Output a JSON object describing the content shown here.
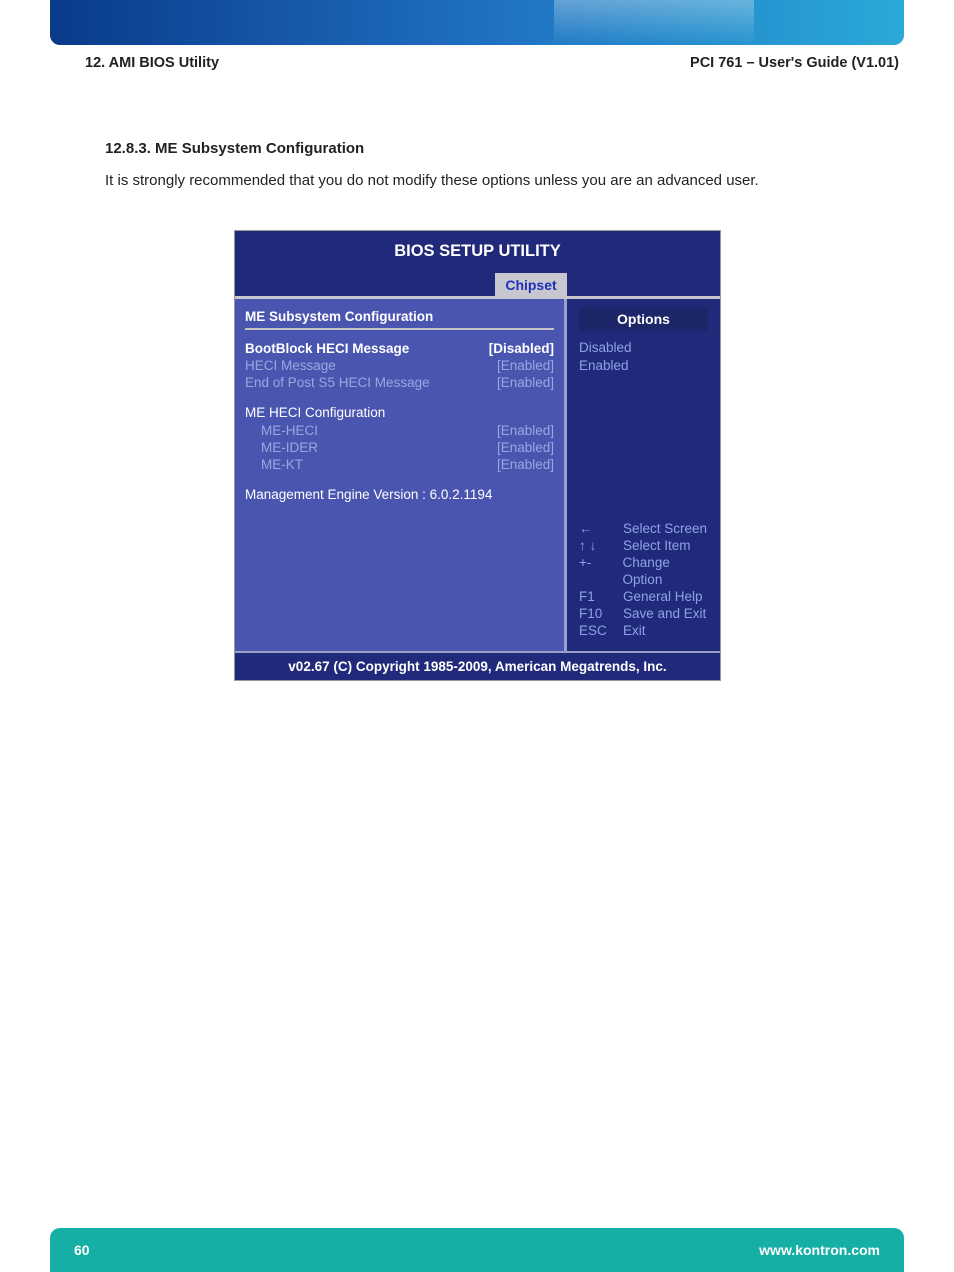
{
  "header": {
    "left": "12. AMI BIOS Utility",
    "right": "PCI 761 – User's Guide (V1.01)"
  },
  "section": {
    "number_title": "12.8.3. ME Subsystem Configuration",
    "intro": "It is strongly recommended that you do not modify these options unless you are an advanced user."
  },
  "bios": {
    "title": "BIOS SETUP UTILITY",
    "active_tab": "Chipset",
    "panel_title": "ME Subsystem Configuration",
    "settings_a": [
      {
        "label": "BootBlock HECI Message",
        "value": "[Disabled]",
        "active": true
      },
      {
        "label": "HECI Message",
        "value": "[Enabled]",
        "active": false
      },
      {
        "label": "End of Post S5 HECI Message",
        "value": "[Enabled]",
        "active": false
      }
    ],
    "subhead": "ME HECI Configuration",
    "settings_b": [
      {
        "label": "ME-HECI",
        "value": "[Enabled]"
      },
      {
        "label": "ME-IDER",
        "value": "[Enabled]"
      },
      {
        "label": "ME-KT",
        "value": "[Enabled]"
      }
    ],
    "me_version": "Management Engine Version  : 6.0.2.1194",
    "options_header": "Options",
    "options": [
      "Disabled",
      "Enabled"
    ],
    "nav": [
      {
        "key": "←",
        "desc": "Select Screen"
      },
      {
        "key": "↑ ↓",
        "desc": "Select Item"
      },
      {
        "key": "+-",
        "desc": "Change Option"
      },
      {
        "key": "F1",
        "desc": "General Help"
      },
      {
        "key": "F10",
        "desc": "Save and Exit"
      },
      {
        "key": "ESC",
        "desc": "Exit"
      }
    ],
    "footer": "v02.67 (C) Copyright 1985-2009, American Megatrends, Inc."
  },
  "page_footer": {
    "page_no": "60",
    "site": "www.kontron.com"
  }
}
